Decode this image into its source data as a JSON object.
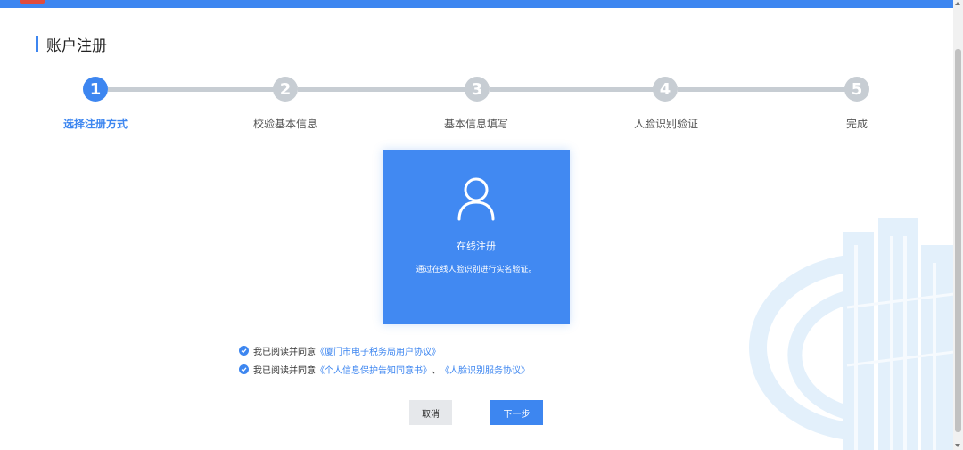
{
  "page": {
    "title": "账户注册"
  },
  "steps": [
    {
      "number": "1",
      "label": "选择注册方式",
      "active": true
    },
    {
      "number": "2",
      "label": "校验基本信息",
      "active": false
    },
    {
      "number": "3",
      "label": "基本信息填写",
      "active": false
    },
    {
      "number": "4",
      "label": "人脸识别验证",
      "active": false
    },
    {
      "number": "5",
      "label": "完成",
      "active": false
    }
  ],
  "card": {
    "icon": "user-icon",
    "title": "在线注册",
    "description": "通过在线人脸识别进行实名验证。"
  },
  "agreements": [
    {
      "prefix": "我已阅读并同意",
      "link1": "《厦门市电子税务局用户协议》",
      "separator": "",
      "link2": ""
    },
    {
      "prefix": "我已阅读并同意",
      "link1": "《个人信息保护告知同意书》",
      "separator": "、",
      "link2": "《人脸识别服务协议》"
    }
  ],
  "buttons": {
    "cancel": "取消",
    "next": "下一步"
  },
  "colors": {
    "primary": "#3d86f0",
    "inactive": "#c7cdd3",
    "card": "#4189f2"
  }
}
